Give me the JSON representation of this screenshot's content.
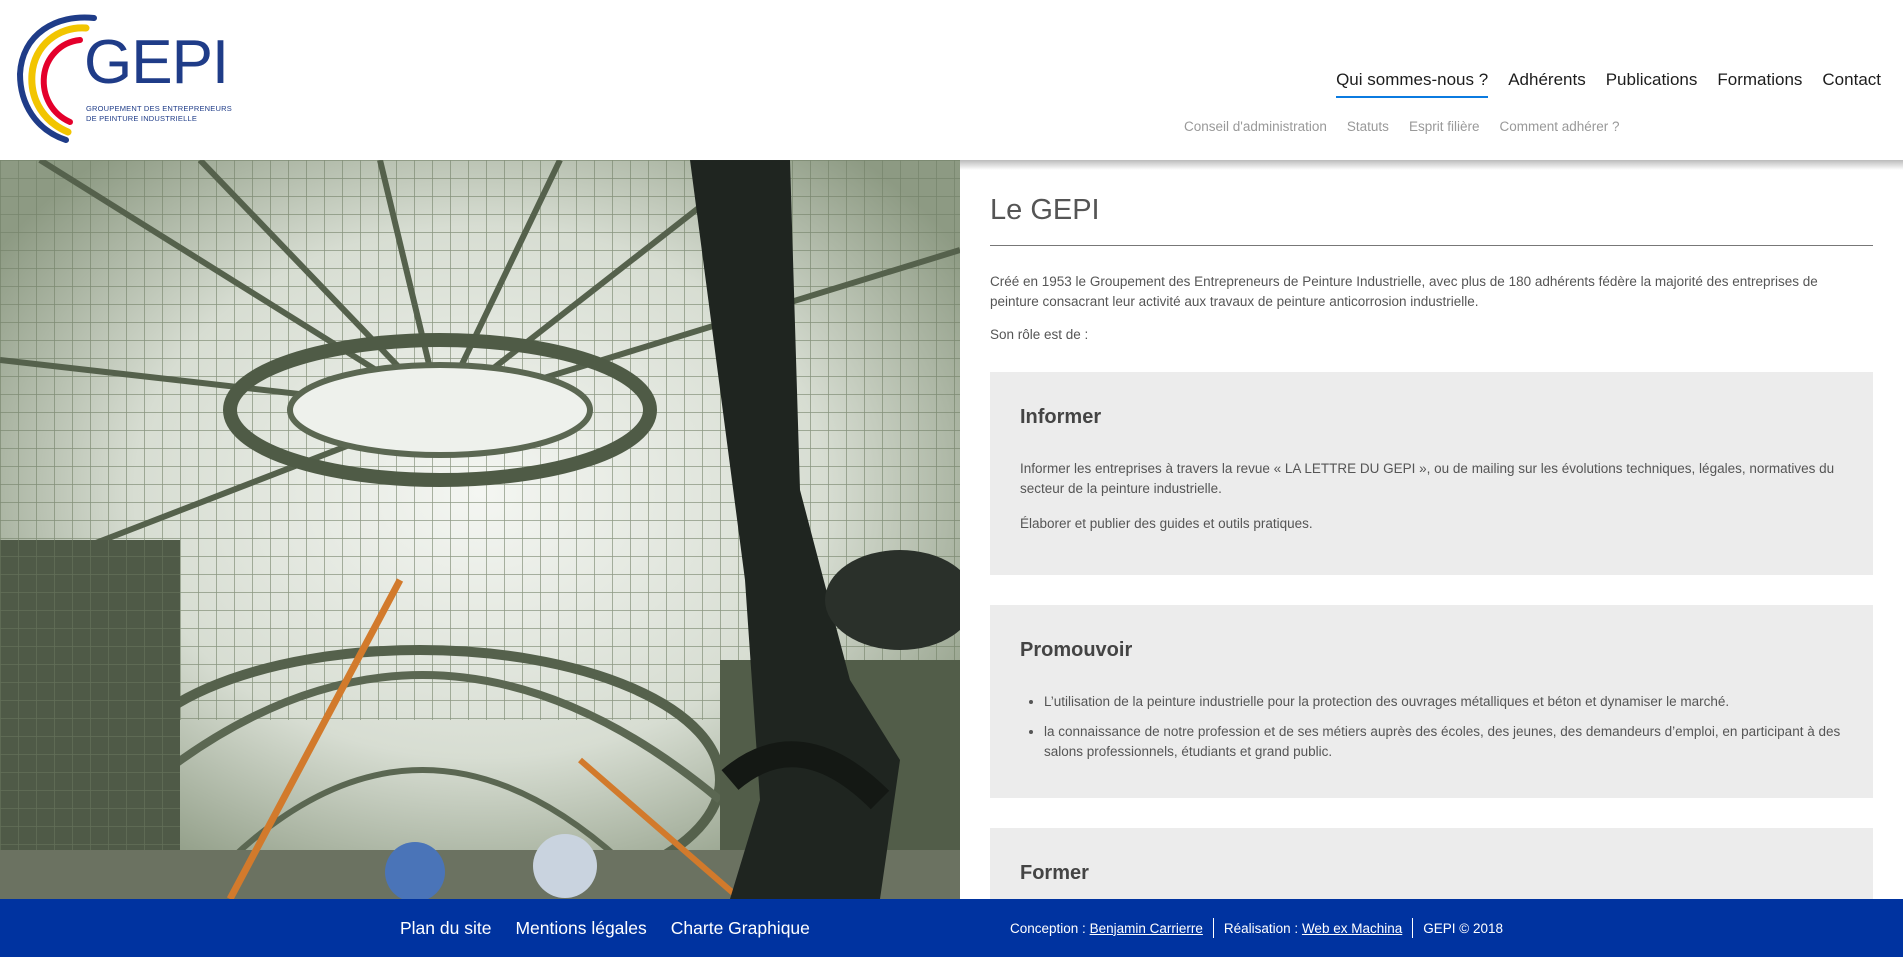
{
  "brand": {
    "logo_word": "GEPI",
    "logo_line1": "GROUPEMENT DES ENTREPRENEURS",
    "logo_line2": "DE PEINTURE INDUSTRIELLE",
    "colors": {
      "blue": "#1f3c88",
      "yellow": "#f2c500",
      "red": "#e4002b",
      "accent": "#0b7be0",
      "footer": "#0033a0"
    }
  },
  "nav": {
    "main": [
      {
        "label": "Qui sommes-nous ?",
        "active": true
      },
      {
        "label": "Adhérents"
      },
      {
        "label": "Publications"
      },
      {
        "label": "Formations"
      },
      {
        "label": "Contact"
      }
    ],
    "sub": [
      {
        "label": "Conseil d'administration"
      },
      {
        "label": "Statuts"
      },
      {
        "label": "Esprit filière"
      },
      {
        "label": "Comment adhérer ?"
      }
    ]
  },
  "page": {
    "title": "Le GEPI",
    "intro": "Créé en 1953 le Groupement des Entrepreneurs de Peinture Industrielle, avec plus de 180 adhérents fédère la majorité des entreprises de peinture consacrant leur activité aux travaux de peinture anticorrosion industrielle.",
    "role": "Son rôle est de :",
    "cards": [
      {
        "title": "Informer",
        "paragraphs": [
          "Informer les entreprises à travers la revue « LA LETTRE DU GEPI », ou de mailing sur les évolutions techniques, légales, normatives du secteur de la peinture industrielle.",
          "Élaborer et publier des guides et outils pratiques."
        ]
      },
      {
        "title": "Promouvoir",
        "bullets": [
          "L’utilisation de la peinture industrielle pour la protection des ouvrages métalliques et béton et dynamiser le marché.",
          "la connaissance de notre profession et de ses métiers auprès des écoles, des jeunes, des demandeurs d’emploi,  en participant à des salons professionnels, étudiants et grand public."
        ]
      },
      {
        "title": "Former"
      }
    ]
  },
  "footer": {
    "links": [
      "Plan du site",
      "Mentions légales",
      "Charte Graphique"
    ],
    "conception_label": "Conception :",
    "conception_name": "Benjamin Carrierre",
    "realisation_label": "Réalisation :",
    "realisation_name": "Web ex Machina",
    "copyright": "GEPI © 2018"
  }
}
